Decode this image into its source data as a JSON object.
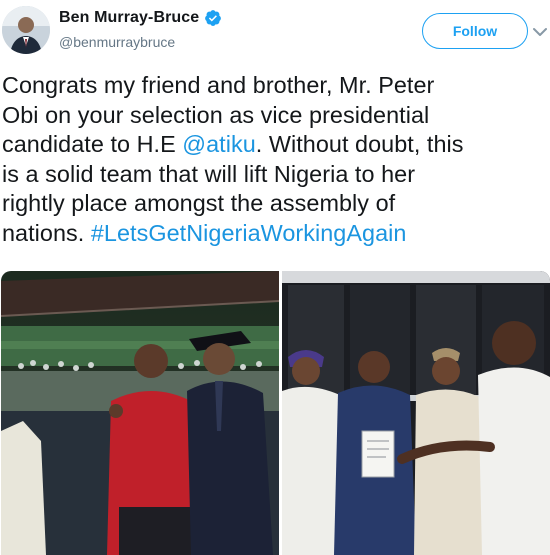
{
  "user": {
    "display_name": "Ben Murray-Bruce",
    "handle": "@benmurraybruce",
    "verified": true,
    "avatar_icon": "profile-photo"
  },
  "follow_button": {
    "label": "Follow"
  },
  "menu_icon": "chevron-down-icon",
  "tweet": {
    "line1": "Congrats my friend and brother, Mr. Peter",
    "line2": "Obi on your selection as vice presidential",
    "line3_a": "candidate to H.E ",
    "mention": "@atiku",
    "line3_b": ". Without doubt, this",
    "line4": "is a solid team that will lift Nigeria to her",
    "line5": "rightly place amongst the assembly of",
    "line6_a": "nations. ",
    "hashtag": "#LetsGetNigeriaWorkingAgain"
  },
  "media": {
    "photos": [
      "stadium-photo",
      "document-handover-photo"
    ]
  },
  "colors": {
    "accent": "#1da1f2",
    "link": "#1b95e0",
    "text": "#14171a",
    "secondary": "#657786"
  }
}
